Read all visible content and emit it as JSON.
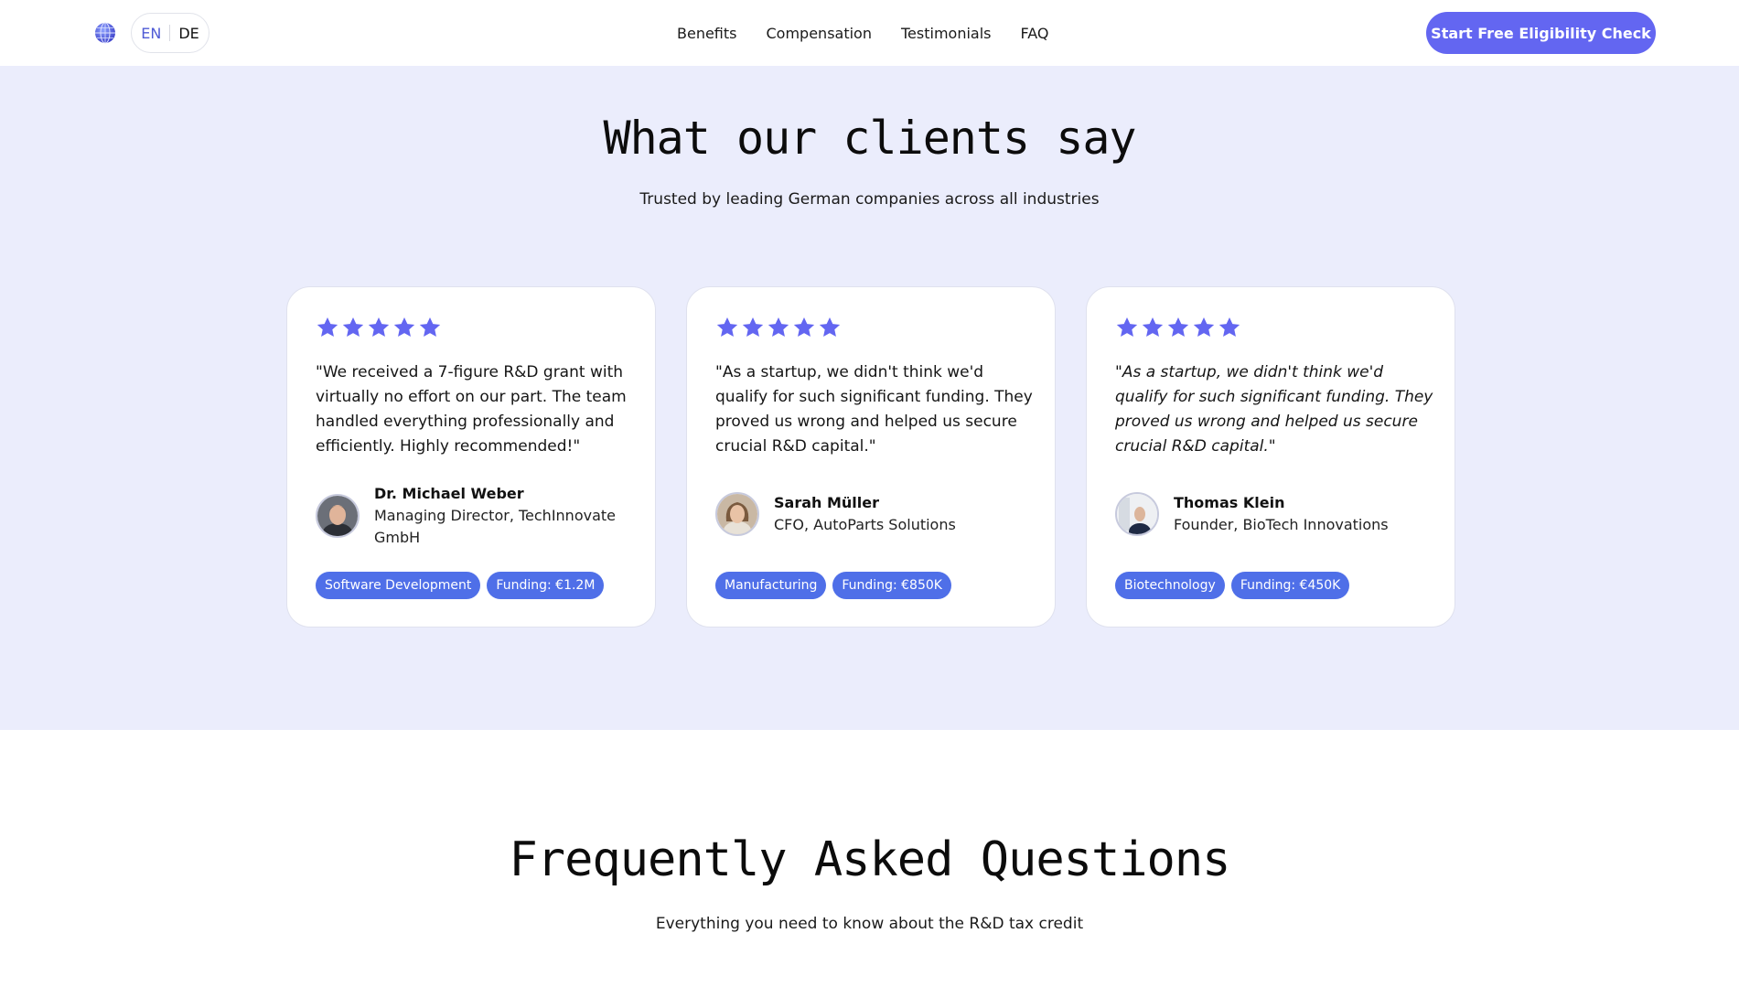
{
  "nav": {
    "globe_icon": "globe-icon",
    "languages": [
      "EN",
      "DE"
    ],
    "active_language": "EN",
    "links": [
      "Benefits",
      "Compensation",
      "Testimonials",
      "FAQ"
    ],
    "cta_label": "Start Free Eligibility Check"
  },
  "colors": {
    "accent": "#6366f1",
    "star": "#6366f1",
    "tag": "#4f6fe8",
    "section_bg": "#ebedfc"
  },
  "testimonials": {
    "title": "What our clients say",
    "subtitle": "Trusted by leading German companies across all industries",
    "cards": [
      {
        "rating": 5,
        "quote": "\"We received a 7-figure R&D grant with virtually no effort on our part. The team handled everything professionally and efficiently. Highly recommended!\"",
        "name": "Dr. Michael Weber",
        "role": "Managing Director, TechInnovate GmbH",
        "tags": [
          "Software Development",
          "Funding: €1.2M"
        ]
      },
      {
        "rating": 5,
        "quote": "\"As a startup, we didn't think we'd qualify for such significant funding. They proved us wrong and helped us secure crucial R&D capital.\"",
        "name": "Sarah Müller",
        "role": "CFO, AutoParts Solutions",
        "tags": [
          "Manufacturing",
          "Funding: €850K"
        ]
      },
      {
        "rating": 5,
        "quote": "\"As a startup, we didn't think we'd qualify for such significant funding. They proved us wrong and helped us secure crucial R&D capital.\"",
        "name": "Thomas Klein",
        "role": "Founder, BioTech Innovations",
        "tags": [
          "Biotechnology",
          "Funding: €450K"
        ]
      }
    ]
  },
  "faq": {
    "title": "Frequently Asked Questions",
    "subtitle": "Everything you need to know about the R&D tax credit"
  }
}
